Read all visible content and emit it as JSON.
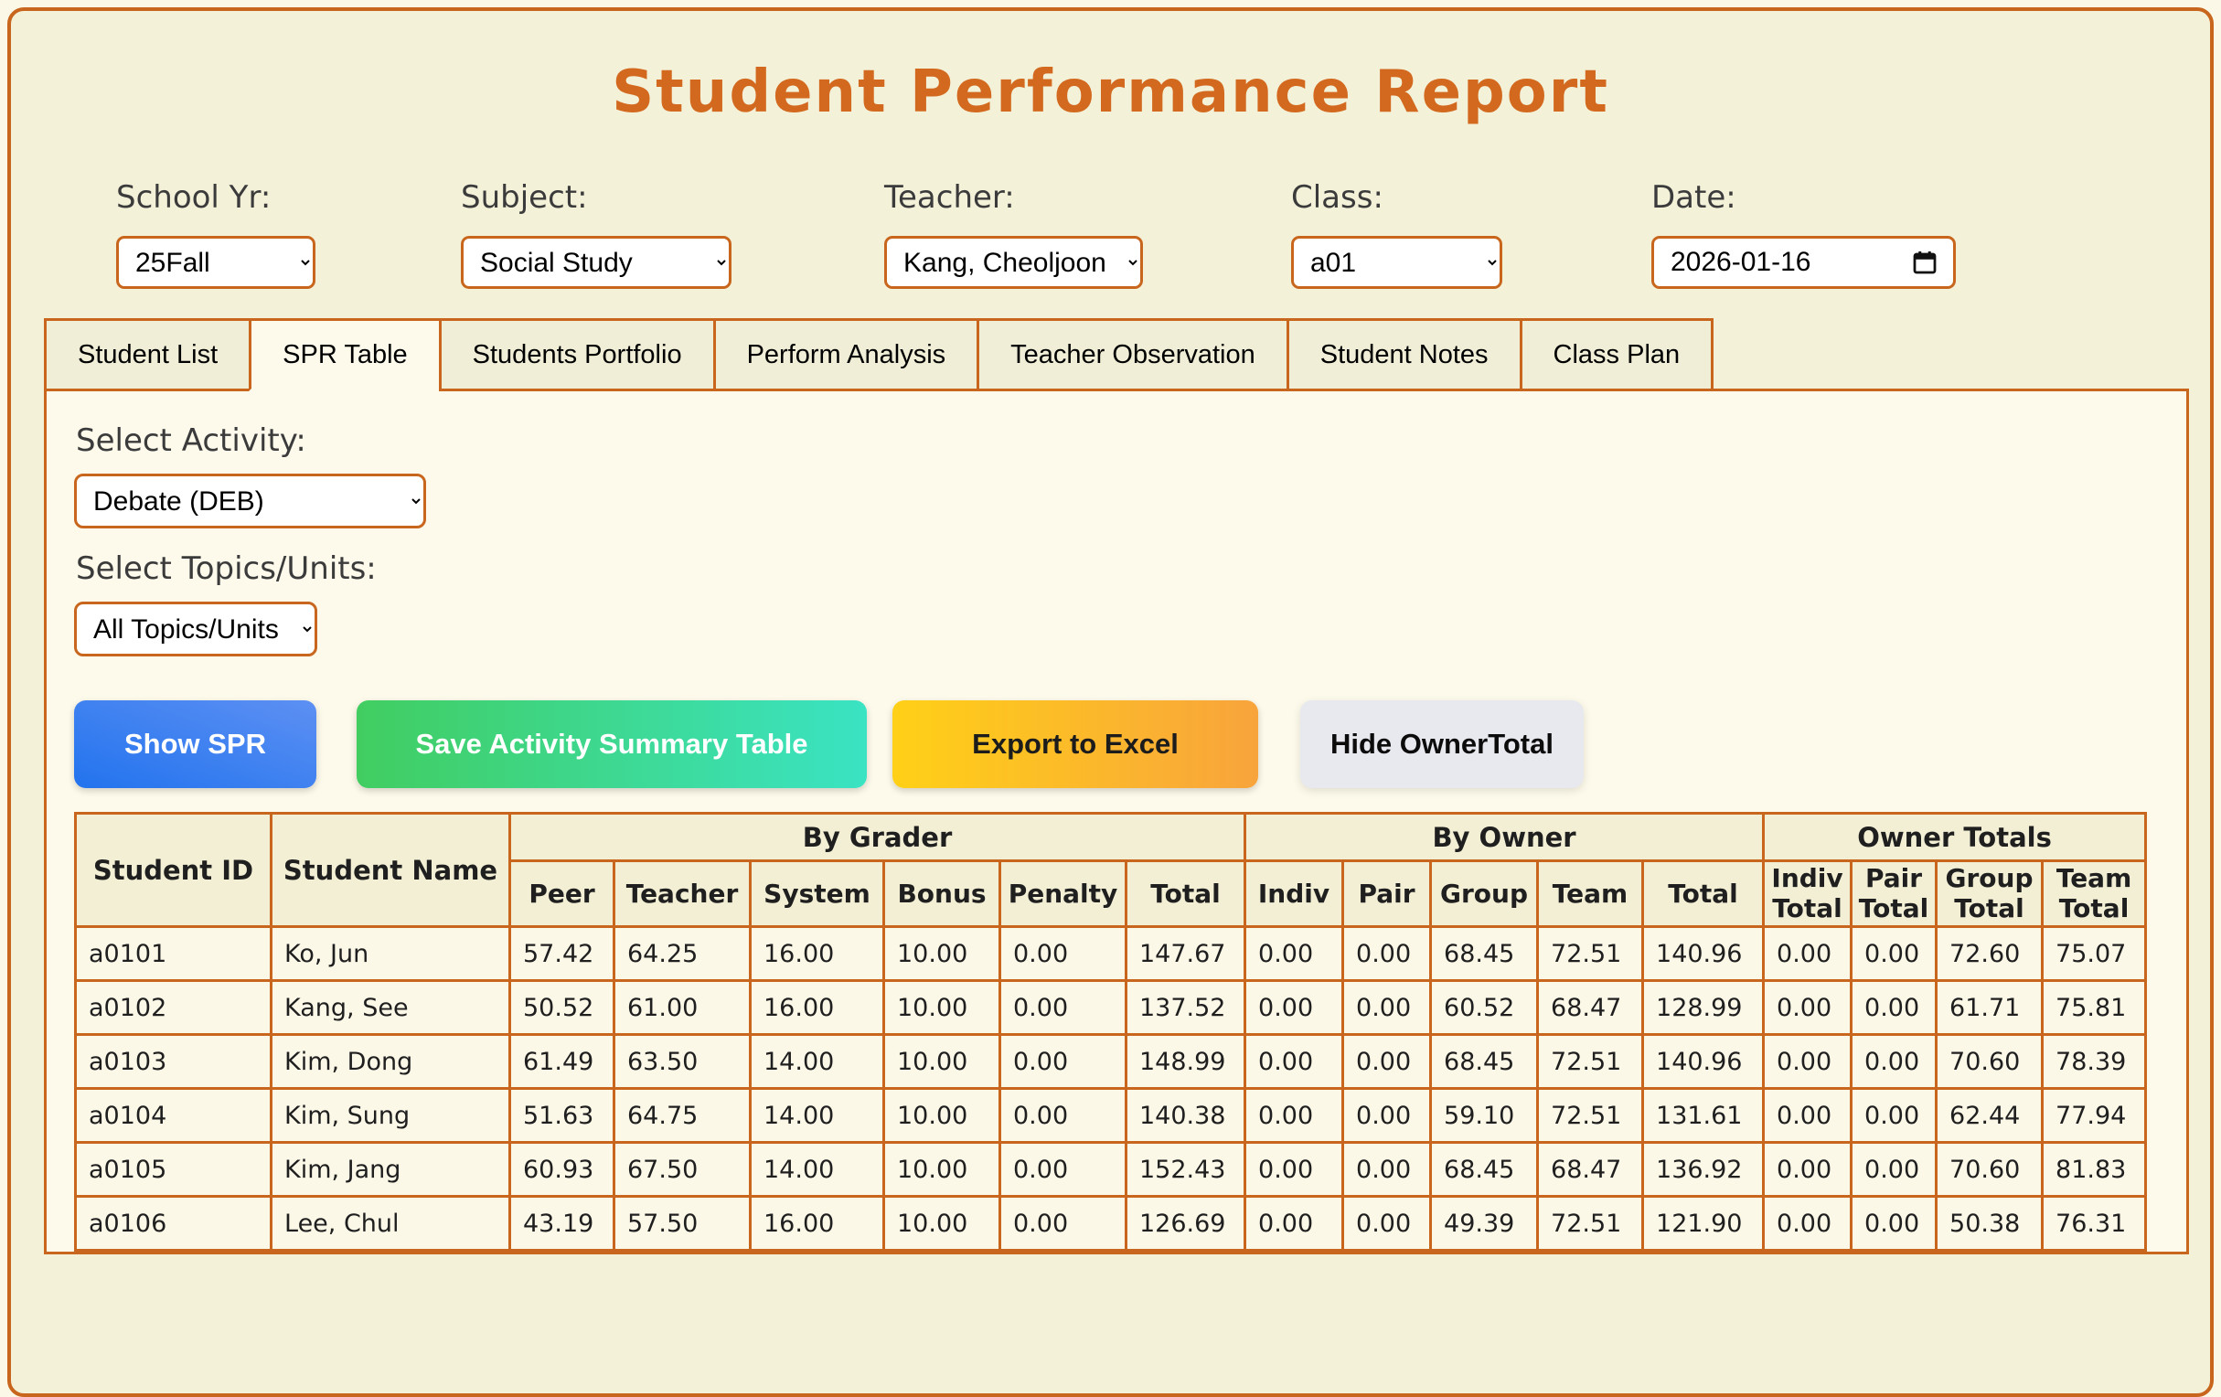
{
  "title": "Student Performance Report",
  "filters": {
    "school_yr": {
      "label": "School Yr:",
      "value": "25Fall"
    },
    "subject": {
      "label": "Subject:",
      "value": "Social Study"
    },
    "teacher": {
      "label": "Teacher:",
      "value": "Kang, Cheoljoon"
    },
    "class": {
      "label": "Class:",
      "value": "a01"
    },
    "date": {
      "label": "Date:",
      "value": "2026-01-16"
    }
  },
  "tabs": [
    {
      "label": "Student List",
      "active": false
    },
    {
      "label": "SPR Table",
      "active": true
    },
    {
      "label": "Students Portfolio",
      "active": false
    },
    {
      "label": "Perform Analysis",
      "active": false
    },
    {
      "label": "Teacher Observation",
      "active": false
    },
    {
      "label": "Student Notes",
      "active": false
    },
    {
      "label": "Class Plan",
      "active": false
    }
  ],
  "panel": {
    "activity_label": "Select Activity:",
    "activity_value": "Debate (DEB)",
    "topics_label": "Select Topics/Units:",
    "topics_value": "All Topics/Units",
    "buttons": {
      "show_spr": "Show SPR",
      "save_summary": "Save Activity Summary Table",
      "export_excel": "Export to Excel",
      "hide_owner_total": "Hide OwnerTotal"
    }
  },
  "colors": {
    "accent_orange": "#c8661d",
    "title_orange": "#d2691e",
    "show_btn_blue": "#2273ee",
    "save_btn_green": "#41cd60",
    "export_btn_yellow": "#ffd017",
    "hide_btn_gray": "#e8e9ee"
  },
  "table": {
    "corner": {
      "student_id": "Student ID",
      "student_name": "Student Name"
    },
    "groups": {
      "by_grader": "By Grader",
      "by_owner": "By Owner",
      "owner_totals": "Owner Totals"
    },
    "sub": {
      "peer": "Peer",
      "teacher": "Teacher",
      "system": "System",
      "bonus": "Bonus",
      "penalty": "Penalty",
      "total_grader": "Total",
      "indiv": "Indiv",
      "pair": "Pair",
      "group": "Group",
      "team": "Team",
      "total_owner": "Total",
      "indiv_total": "Indiv\nTotal",
      "pair_total": "Pair\nTotal",
      "group_total": "Group\nTotal",
      "team_total": "Team\nTotal"
    },
    "rows": [
      [
        "a0101",
        "Ko, Jun",
        "57.42",
        "64.25",
        "16.00",
        "10.00",
        "0.00",
        "147.67",
        "0.00",
        "0.00",
        "68.45",
        "72.51",
        "140.96",
        "0.00",
        "0.00",
        "72.60",
        "75.07"
      ],
      [
        "a0102",
        "Kang, See",
        "50.52",
        "61.00",
        "16.00",
        "10.00",
        "0.00",
        "137.52",
        "0.00",
        "0.00",
        "60.52",
        "68.47",
        "128.99",
        "0.00",
        "0.00",
        "61.71",
        "75.81"
      ],
      [
        "a0103",
        "Kim, Dong",
        "61.49",
        "63.50",
        "14.00",
        "10.00",
        "0.00",
        "148.99",
        "0.00",
        "0.00",
        "68.45",
        "72.51",
        "140.96",
        "0.00",
        "0.00",
        "70.60",
        "78.39"
      ],
      [
        "a0104",
        "Kim, Sung",
        "51.63",
        "64.75",
        "14.00",
        "10.00",
        "0.00",
        "140.38",
        "0.00",
        "0.00",
        "59.10",
        "72.51",
        "131.61",
        "0.00",
        "0.00",
        "62.44",
        "77.94"
      ],
      [
        "a0105",
        "Kim, Jang",
        "60.93",
        "67.50",
        "14.00",
        "10.00",
        "0.00",
        "152.43",
        "0.00",
        "0.00",
        "68.45",
        "68.47",
        "136.92",
        "0.00",
        "0.00",
        "70.60",
        "81.83"
      ],
      [
        "a0106",
        "Lee, Chul",
        "43.19",
        "57.50",
        "16.00",
        "10.00",
        "0.00",
        "126.69",
        "0.00",
        "0.00",
        "49.39",
        "72.51",
        "121.90",
        "0.00",
        "0.00",
        "50.38",
        "76.31"
      ]
    ]
  }
}
